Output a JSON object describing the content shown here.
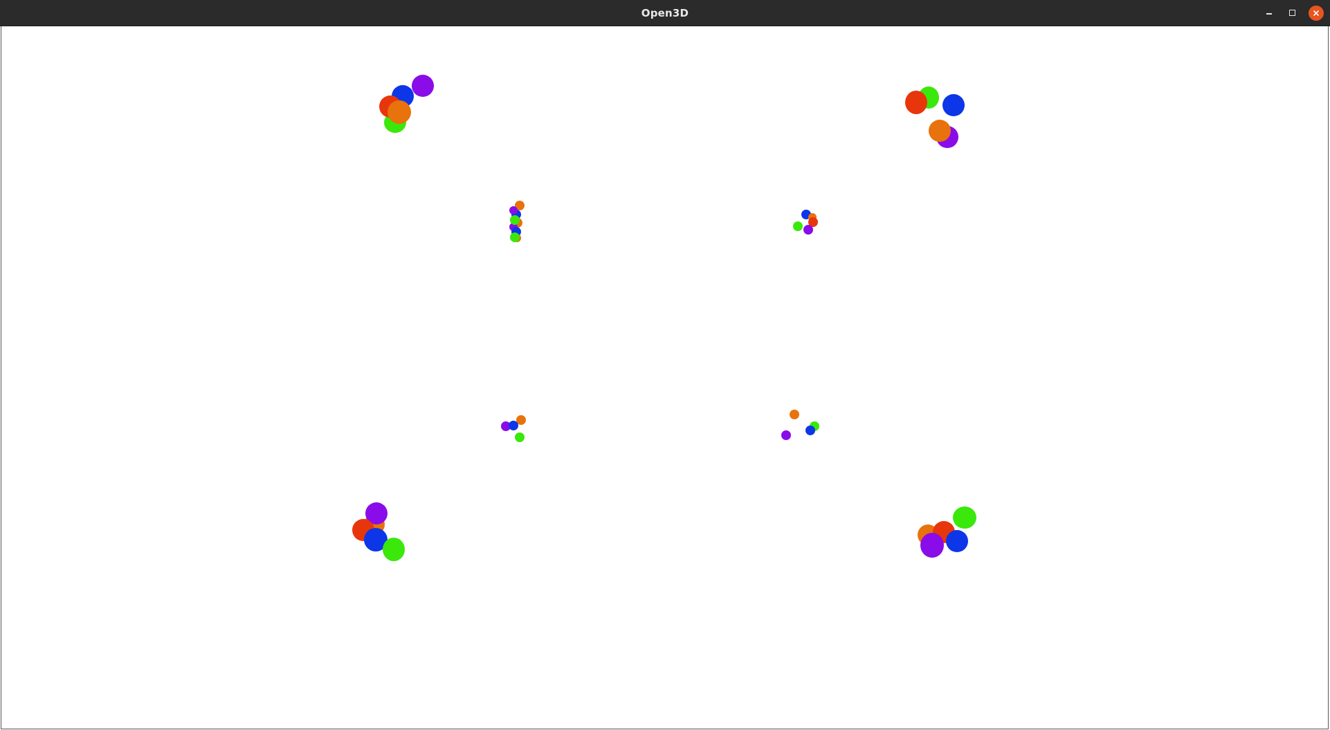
{
  "window": {
    "title": "Open3D"
  },
  "colors": {
    "titlebar": "#2b2b2b",
    "close_button": "#e9541f",
    "background": "#ffffff",
    "red": "#e8360c",
    "orange": "#e8720c",
    "green": "#3ae80c",
    "blue": "#0c36e8",
    "purple": "#8a0ce8"
  },
  "icons": {
    "minimize": "minimize-icon",
    "maximize": "maximize-icon",
    "close": "close-icon"
  },
  "scene": {
    "clusters": 8,
    "sphere_colors": [
      "red",
      "orange",
      "green",
      "blue",
      "purple"
    ]
  }
}
